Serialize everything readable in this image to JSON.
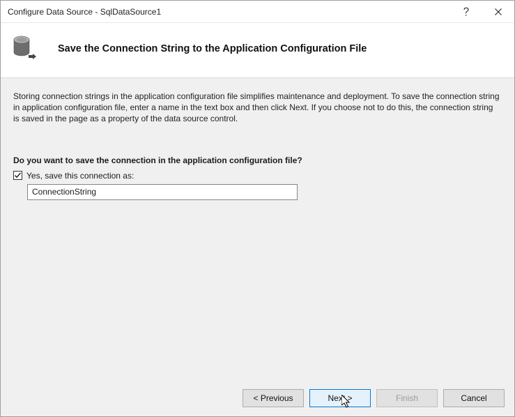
{
  "window": {
    "title": "Configure Data Source - SqlDataSource1"
  },
  "header": {
    "title": "Save the Connection String to the Application Configuration File"
  },
  "body": {
    "intro": "Storing connection strings in the application configuration file simplifies maintenance and deployment. To save the connection string in application configuration file, enter a name in the text box and then click Next. If you choose not to do this, the connection string is saved in the page as a property of the data source control.",
    "question": "Do you want to save the connection in the application configuration file?",
    "checkbox_label": "Yes, save this connection as:",
    "connection_name": "ConnectionString"
  },
  "buttons": {
    "previous": "< Previous",
    "next": "Next >",
    "finish": "Finish",
    "cancel": "Cancel"
  }
}
